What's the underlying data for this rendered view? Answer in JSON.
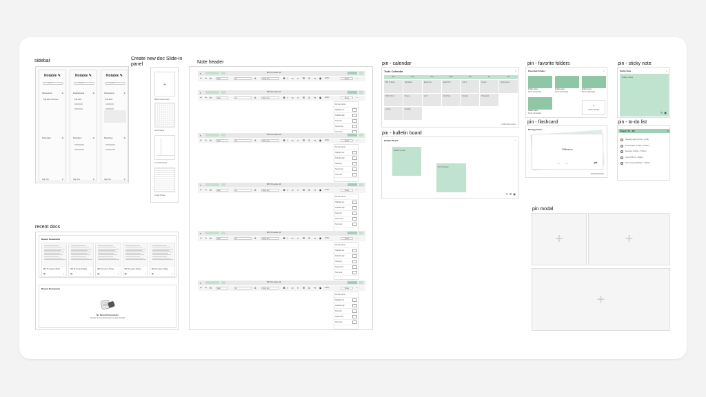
{
  "sections": {
    "sidebar": "sidebar",
    "create_panel": "Create new doc Slide-in panel",
    "note_header": "Note header",
    "pin_calendar": "pin - calendar",
    "pin_favorite": "pin - favorite folders",
    "pin_sticky": "pin - sticky note",
    "pin_bulletin": "pin - bulletin board",
    "pin_flashcard": "pin - flashcard",
    "pin_todo": "pin - to-do list",
    "pin_modal": "pin modal",
    "recent_docs": "recent docs"
  },
  "sidebar": {
    "brand": "Notable",
    "search_placeholder": "Search",
    "columns": [
      {
        "group1": "Semesters",
        "item1": "Fall 2022 Semester",
        "group2": "Summary",
        "footer": "Sign Out"
      },
      {
        "group1": "Dashboards",
        "item1": "Fall 2022",
        "group2": "Favorites",
        "footer": "Sign Out"
      },
      {
        "group1": "Semesters",
        "item1": "Fall 2022",
        "group2": "Favorites",
        "footer": "Sign Out"
      }
    ]
  },
  "create_panel": {
    "labels": [
      "Blank Document",
      "Grid Paper",
      "Cornell Notes",
      "Lined Paper"
    ]
  },
  "note_header": {
    "title": "BIO 72 Lecture 10",
    "font": "Arial",
    "size": "12",
    "style": "Body text",
    "zoom": "100%",
    "share": "Share",
    "dropdown": [
      "Format options",
      "Highlight text",
      "Strikethrough",
      "Subscript",
      "Superscript",
      "Text Color"
    ]
  },
  "calendar": {
    "title": "Todo Calendar",
    "days": [
      "Sun",
      "Mon",
      "Tue",
      "Wed",
      "Thu",
      "Fri",
      "Sat"
    ],
    "events": [
      "BIO 72 Exam",
      "Lab Report",
      "Essay Due",
      "Read Ch 4",
      "Quiz 2",
      "Project",
      "Study Group",
      "Office Hours",
      "Review",
      "Lab 3",
      "Final Prep",
      "Meeting",
      "Homework",
      "Lecture",
      "Deadline",
      "Notes"
    ],
    "footer": "+ Add new event"
  },
  "favorite_folders": {
    "title": "Favorited Folders",
    "folders": [
      {
        "name": "Folder name",
        "sub": "Folder subheading"
      },
      {
        "name": "Folder name",
        "sub": "Folder subheading"
      },
      {
        "name": "Folder name",
        "sub": "Folder subheading"
      },
      {
        "name": "Folder name",
        "sub": "Folder subheading"
      }
    ],
    "add_label": "Add a folder"
  },
  "sticky": {
    "title": "Sticky Note",
    "body": "Sticky notes"
  },
  "bulletin": {
    "title": "Bulletin Board",
    "note1": "Notes to self",
    "note2": "Don't forget"
  },
  "flashcard": {
    "title": "Biology Terms",
    "term": "Diffusion",
    "counter": "1/3 Flashcards"
  },
  "todo": {
    "title": "Today's To - Do",
    "items": [
      "Reading review (10 min - 11:00)",
      "Finish project (1:00pm - 3:00pm)",
      "Readings (4:00pm - 5:00pm)",
      "Gym (3:30 pm - 5:00pm)",
      "Client meeting (6:00pm - 7:00pm)"
    ]
  },
  "recent": {
    "title": "Recent Documents",
    "docs": [
      "BIO 72 Lecture 9 Notes",
      "BIO 72 Lecture 8 Notes",
      "BIO 72 Lecture 7 Notes",
      "BIO 72 Lecture 6 Notes",
      "BIO 72 Lecture 5 Notes"
    ],
    "empty_title": "Recent Documents",
    "empty_heading": "No Recent Documents",
    "empty_sub": "Create a new document to get started"
  }
}
